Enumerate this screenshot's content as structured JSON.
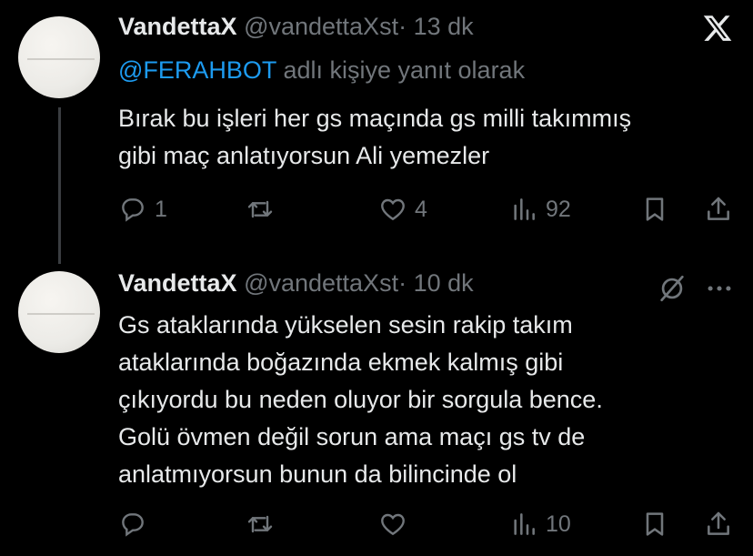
{
  "brand": {
    "logo": "x-logo",
    "color": "#e7e9ea"
  },
  "tweets": [
    {
      "name": "VandettaX",
      "handle": "@vandettaXst",
      "dot": "·",
      "time": "13 dk",
      "reply_to": {
        "mention": "@FERAHBOT",
        "text": "adlı kişiye yanıt olarak"
      },
      "lines": [
        "Bırak bu işleri her gs maçında gs milli takımmış",
        "gibi maç anlatıyorsun Ali yemezler"
      ],
      "actions": {
        "replies": "1",
        "reposts": "",
        "likes": "4",
        "views": "92"
      }
    },
    {
      "name": "VandettaX",
      "handle": "@vandettaXst",
      "dot": "·",
      "time": "10 dk",
      "lines": [
        "Gs ataklarında yükselen sesin rakip takım",
        "ataklarında boğazında ekmek kalmış gibi",
        "çıkıyordu bu neden oluyor bir sorgula bence.",
        "Golü övmen değil sorun ama maçı gs tv de",
        "anlatmıyorsun bunun da bilincinde ol"
      ],
      "actions": {
        "replies": "",
        "reposts": "",
        "likes": "",
        "views": "10"
      }
    }
  ],
  "colors": {
    "background": "#000000",
    "text": "#e7e9ea",
    "muted": "#71767b",
    "link": "#1d9bf0"
  }
}
